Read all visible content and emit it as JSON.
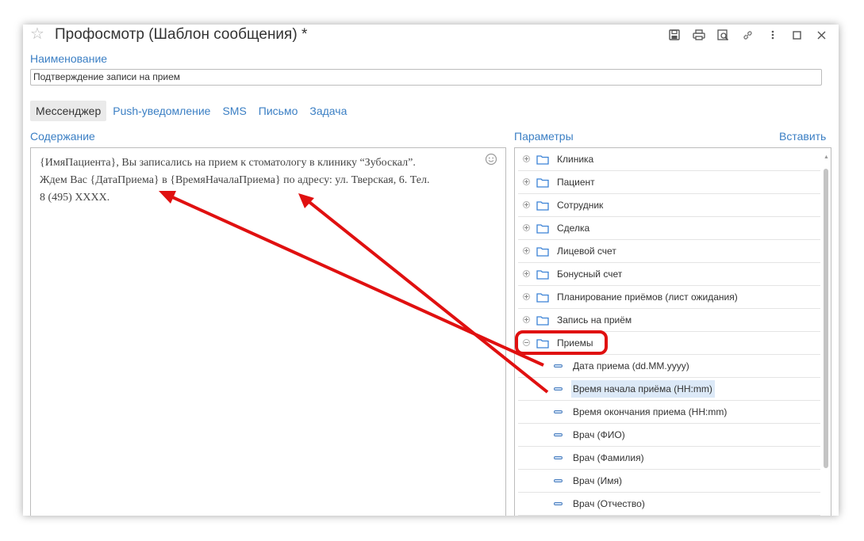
{
  "window": {
    "title": "Профосмотр (Шаблон сообщения) *",
    "toolbar_icons": [
      "save-icon",
      "print-icon",
      "preview-icon",
      "link-icon",
      "more-icon",
      "maximize-icon",
      "close-icon"
    ]
  },
  "name_field": {
    "label": "Наименование",
    "value": "Подтверждение записи на прием"
  },
  "tabs": [
    {
      "label": "Мессенджер",
      "active": true
    },
    {
      "label": "Push-уведомление",
      "active": false
    },
    {
      "label": "SMS",
      "active": false
    },
    {
      "label": "Письмо",
      "active": false
    },
    {
      "label": "Задача",
      "active": false
    }
  ],
  "content": {
    "label": "Содержание",
    "lines": [
      "{ИмяПациента}, Вы записались на прием к стоматологу в клинику “Зубоскал”.",
      "Ждем Вас {ДатаПриема} в {ВремяНачалаПриема} по адресу: ул. Тверская, 6. Тел.",
      "8 (495) XXXX."
    ]
  },
  "params": {
    "label": "Параметры",
    "insert_label": "Вставить",
    "groups": [
      {
        "label": "Клиника",
        "expanded": false
      },
      {
        "label": "Пациент",
        "expanded": false
      },
      {
        "label": "Сотрудник",
        "expanded": false
      },
      {
        "label": "Сделка",
        "expanded": false
      },
      {
        "label": "Лицевой счет",
        "expanded": false
      },
      {
        "label": "Бонусный счет",
        "expanded": false
      },
      {
        "label": "Планирование приёмов (лист ожидания)",
        "expanded": false
      },
      {
        "label": "Запись на приём",
        "expanded": false
      },
      {
        "label": "Приемы",
        "expanded": true
      }
    ],
    "items": [
      {
        "label": "Дата приема (dd.MM.yyyy)",
        "selected": false
      },
      {
        "label": "Время начала приёма (HH:mm)",
        "selected": true
      },
      {
        "label": "Время окончания приема (HH:mm)",
        "selected": false
      },
      {
        "label": "Врач (ФИО)",
        "selected": false
      },
      {
        "label": "Врач (Фамилия)",
        "selected": false
      },
      {
        "label": "Врач (Имя)",
        "selected": false
      },
      {
        "label": "Врач (Отчество)",
        "selected": false
      }
    ]
  },
  "colors": {
    "link": "#3b7fc4",
    "annotation": "#e01010",
    "selection": "#dce9f7",
    "folder": "#3b82d6"
  }
}
